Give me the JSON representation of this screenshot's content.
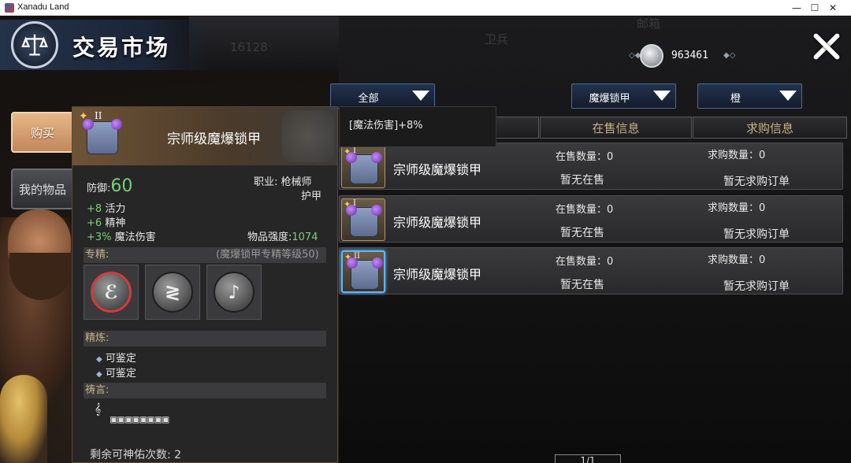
{
  "window": {
    "title": "Xanadu Land",
    "icon": "app-icon"
  },
  "header": {
    "title": "交易市场",
    "emblem_icon": "scales-icon",
    "currency_value": "963461",
    "currency_icon": "silver-coin-icon"
  },
  "background": {
    "ghost_texts": [
      "16128",
      "邮箱",
      "卫兵"
    ]
  },
  "tabs": [
    {
      "label": "购买",
      "active": true
    },
    {
      "label": "我的物品",
      "active": false
    }
  ],
  "filters": {
    "category": "全部",
    "item_type": "魔爆锁甲",
    "quality": "橙"
  },
  "columns": {
    "sale": "在售信息",
    "buy": "求购信息"
  },
  "rows": [
    {
      "tier": "I",
      "name": "宗师级魔爆锁甲",
      "sale_count": "在售数量：0",
      "sale_status": "暂无在售",
      "buy_count": "求购数量：0",
      "buy_status": "暂无求购订单",
      "selected": false
    },
    {
      "tier": "I",
      "name": "宗师级魔爆锁甲",
      "sale_count": "在售数量：0",
      "sale_status": "暂无在售",
      "buy_count": "求购数量：0",
      "buy_status": "暂无求购订单",
      "selected": false
    },
    {
      "tier": "II",
      "name": "宗师级魔爆锁甲",
      "sale_count": "在售数量：0",
      "sale_status": "暂无在售",
      "buy_count": "求购数量：0",
      "buy_status": "暂无求购订单",
      "selected": true
    }
  ],
  "affix_popup": {
    "text": "[魔法伤害]+8%"
  },
  "tooltip": {
    "tier": "II",
    "name": "宗师级魔爆锁甲",
    "defense_label": "防御:",
    "defense_value": "60",
    "class_label": "职业: 枪械师",
    "slot_label": "护甲",
    "stats": [
      {
        "value": "+8",
        "label": "活力"
      },
      {
        "value": "+6",
        "label": "精神"
      },
      {
        "value": "+3%",
        "label": "魔法伤害"
      }
    ],
    "strength_label": "物品强度:",
    "strength_value": "1074",
    "mastery_header": "专精:",
    "mastery_note": "(魔爆锁甲专精等级50)",
    "mastery_icons": [
      "mastery-slash-icon",
      "mastery-wave-icon",
      "mastery-drop-icon"
    ],
    "refine_header": "精炼:",
    "refine_items": [
      "可鉴定",
      "可鉴定"
    ],
    "prayer_header": "祷言:",
    "prayer_runes": "▣▣▣▣▣▣▣▣",
    "blessing_text": "剩余可神佑次数: 2"
  },
  "pager": {
    "text": "1/1"
  },
  "colors": {
    "accent_gold": "#c6b187",
    "stat_green": "#76d178",
    "selection_blue": "#5fb6ff"
  }
}
